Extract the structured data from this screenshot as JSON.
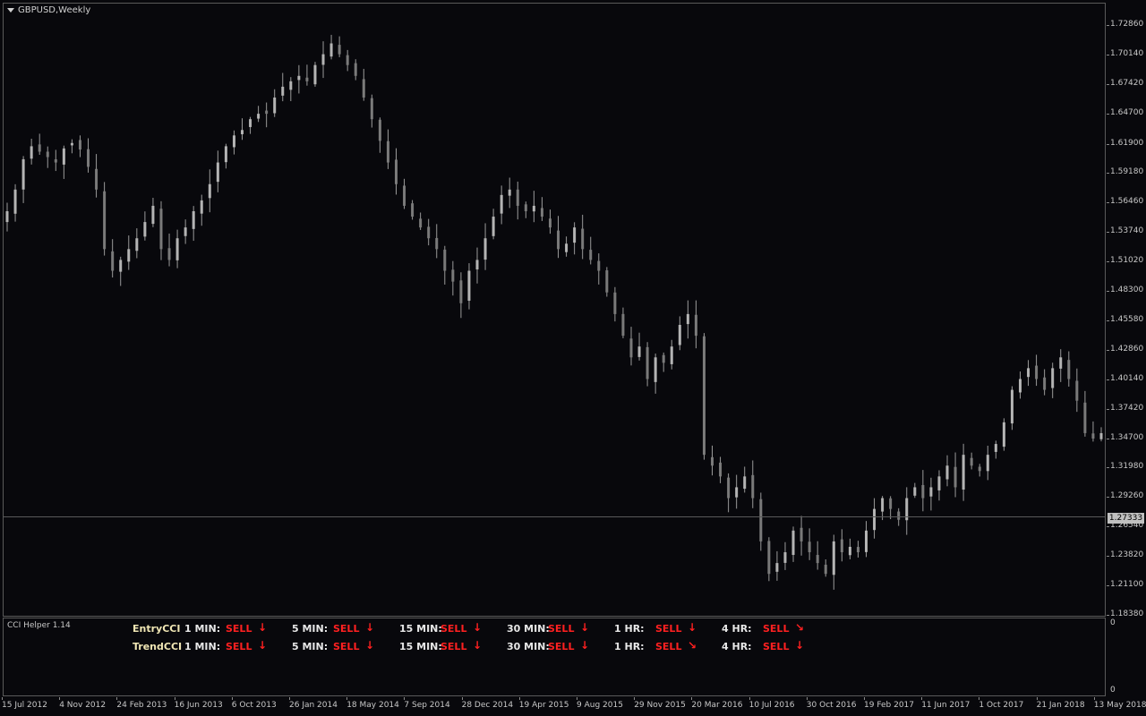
{
  "chart": {
    "symbol": "GBPUSD,Weekly",
    "current_price": "1.27333",
    "current_price_value": 1.27333,
    "price_min": 1.1838,
    "price_max": 1.7286,
    "price_labels": [
      "1.72860",
      "1.70140",
      "1.67420",
      "1.64700",
      "1.61900",
      "1.59180",
      "1.56460",
      "1.53740",
      "1.51020",
      "1.48300",
      "1.45580",
      "1.42860",
      "1.40140",
      "1.37420",
      "1.34700",
      "1.31980",
      "1.29260",
      "1.26540",
      "1.23820",
      "1.21100",
      "1.18380"
    ],
    "time_labels": [
      "15 Jul 2012",
      "4 Nov 2012",
      "24 Feb 2013",
      "16 Jun 2013",
      "6 Oct 2013",
      "26 Jan 2014",
      "18 May 2014",
      "7 Sep 2014",
      "28 Dec 2014",
      "19 Apr 2015",
      "9 Aug 2015",
      "29 Nov 2015",
      "20 Mar 2016",
      "10 Jul 2016",
      "30 Oct 2016",
      "19 Feb 2017",
      "11 Jun 2017",
      "1 Oct 2017",
      "21 Jan 2018",
      "13 May 2018"
    ],
    "colors": {
      "background": "#08080c",
      "candle": "#9a9a9a",
      "grid_line": "#5a5a5a",
      "sell": "#ff2020",
      "label": "#f0e6b4"
    },
    "closes": [
      1.555,
      1.575,
      1.603,
      1.615,
      1.61,
      1.605,
      1.6,
      1.613,
      1.618,
      1.612,
      1.596,
      1.575,
      1.52,
      1.5,
      1.51,
      1.52,
      1.53,
      1.545,
      1.56,
      1.52,
      1.51,
      1.53,
      1.54,
      1.555,
      1.565,
      1.58,
      1.6,
      1.615,
      1.625,
      1.63,
      1.64,
      1.645,
      1.645,
      1.66,
      1.67,
      1.675,
      1.68,
      1.675,
      1.69,
      1.7,
      1.71,
      1.7,
      1.69,
      1.68,
      1.66,
      1.64,
      1.62,
      1.6,
      1.58,
      1.56,
      1.55,
      1.54,
      1.53,
      1.52,
      1.5,
      1.49,
      1.47,
      1.5,
      1.51,
      1.53,
      1.55,
      1.57,
      1.575,
      1.56,
      1.555,
      1.56,
      1.55,
      1.54,
      1.52,
      1.525,
      1.54,
      1.52,
      1.51,
      1.5,
      1.48,
      1.46,
      1.44,
      1.42,
      1.43,
      1.4,
      1.42,
      1.415,
      1.43,
      1.45,
      1.46,
      1.44,
      1.33,
      1.32,
      1.31,
      1.29,
      1.3,
      1.31,
      1.29,
      1.25,
      1.22,
      1.23,
      1.24,
      1.26,
      1.25,
      1.24,
      1.23,
      1.22,
      1.25,
      1.24,
      1.245,
      1.24,
      1.26,
      1.28,
      1.29,
      1.28,
      1.27,
      1.29,
      1.3,
      1.29,
      1.3,
      1.31,
      1.32,
      1.3,
      1.33,
      1.32,
      1.315,
      1.33,
      1.34,
      1.36,
      1.39,
      1.4,
      1.41,
      1.4,
      1.39,
      1.41,
      1.42,
      1.4,
      1.38,
      1.35,
      1.345,
      1.35
    ]
  },
  "indicator": {
    "title": "CCI Helper 1.14",
    "axis_top": "0",
    "axis_bottom": "0",
    "rows": [
      {
        "name": "EntryCCI",
        "cells": [
          {
            "tf": "1 MIN:",
            "signal": "SELL",
            "arrow": "↓"
          },
          {
            "tf": "5 MIN:",
            "signal": "SELL",
            "arrow": "↓"
          },
          {
            "tf": "15 MIN:",
            "signal": "SELL",
            "arrow": "↓"
          },
          {
            "tf": "30 MIN:",
            "signal": "SELL",
            "arrow": "↓"
          },
          {
            "tf": "1 HR:",
            "signal": "SELL",
            "arrow": "↓"
          },
          {
            "tf": "4 HR:",
            "signal": "SELL",
            "arrow": "↘"
          }
        ]
      },
      {
        "name": "TrendCCI",
        "cells": [
          {
            "tf": "1 MIN:",
            "signal": "SELL",
            "arrow": "↓"
          },
          {
            "tf": "5 MIN:",
            "signal": "SELL",
            "arrow": "↓"
          },
          {
            "tf": "15 MIN:",
            "signal": "SELL",
            "arrow": "↓"
          },
          {
            "tf": "30 MIN:",
            "signal": "SELL",
            "arrow": "↓"
          },
          {
            "tf": "1 HR:",
            "signal": "SELL",
            "arrow": "↘"
          },
          {
            "tf": "4 HR:",
            "signal": "SELL",
            "arrow": "↓"
          }
        ]
      }
    ]
  }
}
